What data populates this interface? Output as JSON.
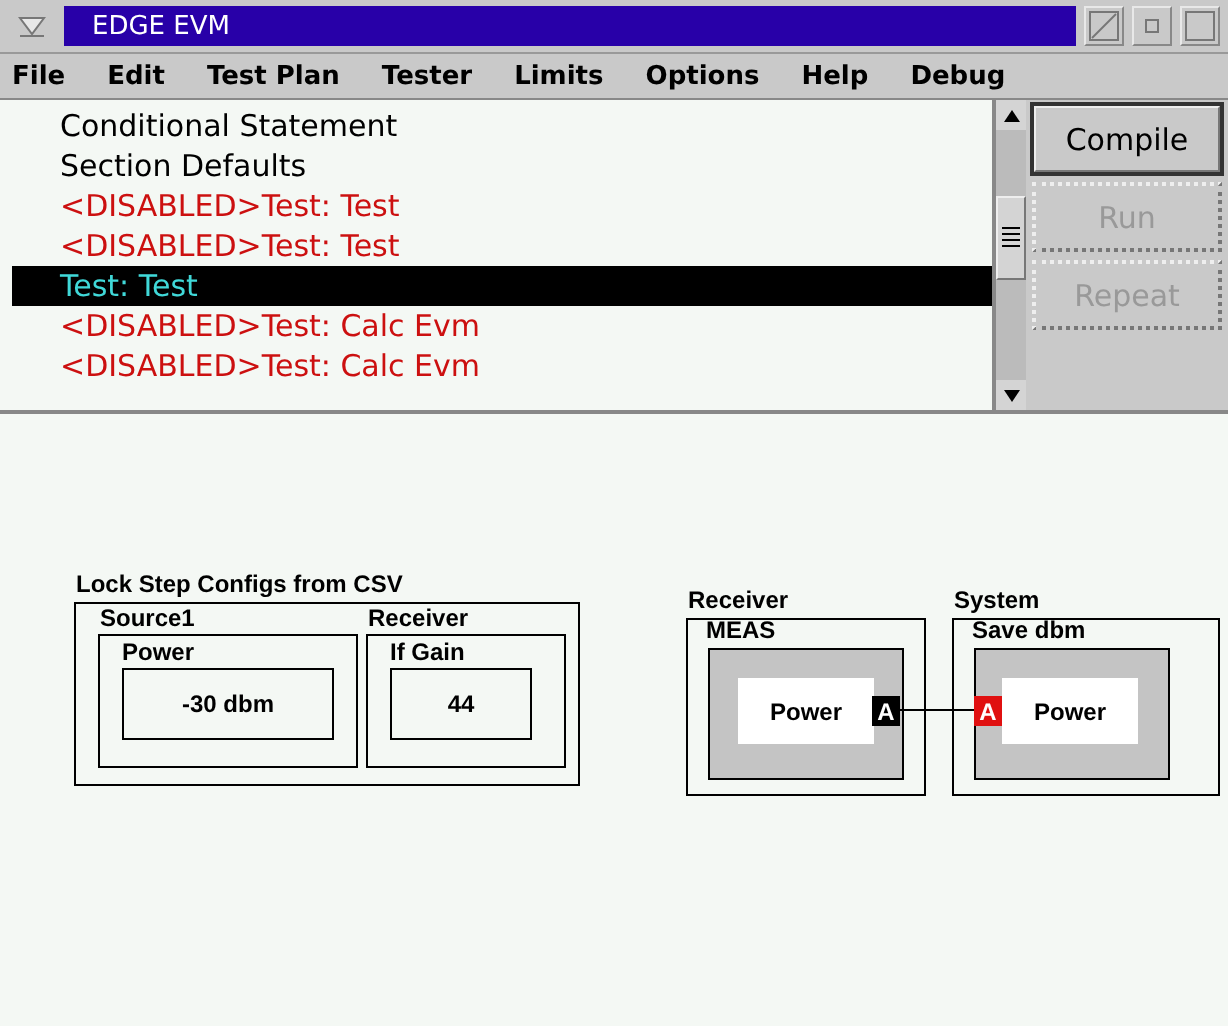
{
  "window": {
    "title": "EDGE EVM"
  },
  "menu": [
    {
      "label": "File"
    },
    {
      "label": "Edit"
    },
    {
      "label": "Test Plan"
    },
    {
      "label": "Tester"
    },
    {
      "label": "Limits"
    },
    {
      "label": "Options"
    },
    {
      "label": "Help"
    },
    {
      "label": "Debug"
    }
  ],
  "test_list": [
    {
      "text": "Conditional Statement",
      "disabled": false,
      "selected": false
    },
    {
      "text": "Section Defaults",
      "disabled": false,
      "selected": false
    },
    {
      "text": "<DISABLED>Test: Test",
      "disabled": true,
      "selected": false
    },
    {
      "text": "<DISABLED>Test: Test",
      "disabled": true,
      "selected": false
    },
    {
      "text": "Test: Test",
      "disabled": false,
      "selected": true
    },
    {
      "text": "<DISABLED>Test: Calc Evm",
      "disabled": true,
      "selected": false
    },
    {
      "text": "<DISABLED>Test: Calc Evm",
      "disabled": true,
      "selected": false
    }
  ],
  "buttons": [
    {
      "label": "Compile",
      "disabled": false
    },
    {
      "label": "Run",
      "disabled": true
    },
    {
      "label": "Repeat",
      "disabled": true
    }
  ],
  "diagram": {
    "group": {
      "title": "Lock Step Configs from CSV",
      "blocks": [
        {
          "category": "Source1",
          "name": "Power",
          "value": "-30 dbm"
        },
        {
          "category": "Receiver",
          "name": "If Gain",
          "value": "44"
        }
      ]
    },
    "nodes": [
      {
        "category": "Receiver",
        "name": "MEAS",
        "param": "Power",
        "port": "A",
        "kind": "output",
        "color": "#000000"
      },
      {
        "category": "System",
        "name": "Save dbm",
        "param": "Power",
        "port": "A",
        "kind": "input",
        "color": "#e01010"
      }
    ]
  }
}
